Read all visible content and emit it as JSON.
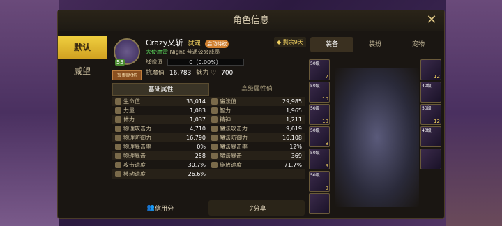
{
  "window": {
    "title": "角色信息"
  },
  "left_tabs": [
    "默认",
    "威望"
  ],
  "profile": {
    "level": "55",
    "copy_btn": "复制昵称",
    "name": "Crazy乂斩",
    "class": "弑魂",
    "badge": "启动特权",
    "guild_rank": "大使摩雷",
    "guild_name": "Night",
    "member": "普通公会成员",
    "exp_label": "经验值",
    "exp_value": "0（0.00%）",
    "power_label": "抗魔值",
    "power_value": "16,783",
    "charm_label": "魅力",
    "charm_value": "700"
  },
  "remaining": "剩余9天",
  "right_tabs": [
    "装备",
    "装扮",
    "宠物"
  ],
  "attr_tabs": [
    "基础属性",
    "高级属性值"
  ],
  "attributes": [
    [
      {
        "label": "生命值",
        "value": "33,014"
      },
      {
        "label": "魔法值",
        "value": "29,985"
      }
    ],
    [
      {
        "label": "力量",
        "value": "1,083"
      },
      {
        "label": "智力",
        "value": "1,965"
      }
    ],
    [
      {
        "label": "体力",
        "value": "1,037"
      },
      {
        "label": "精神",
        "value": "1,211"
      }
    ],
    [
      {
        "label": "物理攻击力",
        "value": "4,710"
      },
      {
        "label": "魔法攻击力",
        "value": "9,619"
      }
    ],
    [
      {
        "label": "物理防御力",
        "value": "16,790"
      },
      {
        "label": "魔法防御力",
        "value": "16,108"
      }
    ],
    [
      {
        "label": "物理暴击率",
        "value": "0%"
      },
      {
        "label": "魔法暴击率",
        "value": "12%"
      }
    ],
    [
      {
        "label": "物理暴击",
        "value": "258"
      },
      {
        "label": "魔法暴击",
        "value": "369"
      }
    ],
    [
      {
        "label": "攻击速度",
        "value": "30.7%"
      },
      {
        "label": "施放速度",
        "value": "71.7%"
      }
    ],
    [
      {
        "label": "移动速度",
        "value": "26.6%"
      },
      {
        "label": "",
        "value": ""
      }
    ]
  ],
  "equip_left": [
    {
      "lv": "50级",
      "plus": "7"
    },
    {
      "lv": "50级",
      "plus": "10"
    },
    {
      "lv": "50级",
      "plus": "10"
    },
    {
      "lv": "50级",
      "plus": "8"
    },
    {
      "lv": "50级",
      "plus": "9"
    },
    {
      "lv": "50级",
      "plus": "9"
    },
    {
      "lv": "",
      "plus": ""
    }
  ],
  "equip_right": [
    {
      "lv": "",
      "plus": "12"
    },
    {
      "lv": "40级",
      "plus": ""
    },
    {
      "lv": "50级",
      "plus": "12"
    },
    {
      "lv": "40级",
      "plus": ""
    },
    {
      "lv": "",
      "plus": ""
    }
  ],
  "bottom": {
    "credit": "信用分",
    "share": "分享"
  }
}
